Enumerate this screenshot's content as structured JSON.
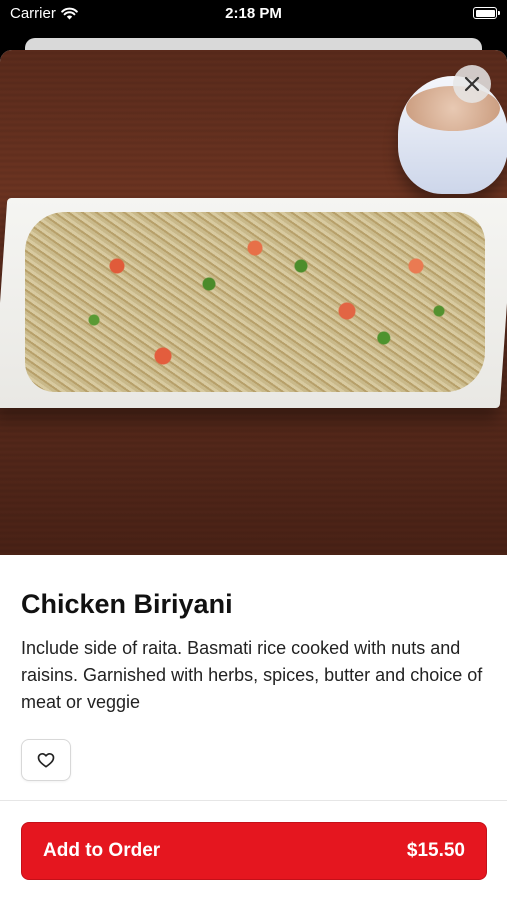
{
  "status_bar": {
    "carrier": "Carrier",
    "time": "2:18 PM",
    "icons": [
      "wifi-icon",
      "battery-icon"
    ]
  },
  "item": {
    "image_alt": "Chicken Biriyani dish photo",
    "name": "Chicken Biriyani",
    "description": "Include side of raita. Basmati rice cooked with nuts and raisins. Garnished with herbs, spices, butter and choice of meat or veggie"
  },
  "actions": {
    "close_icon": "close-icon",
    "favorite_icon": "heart-icon",
    "add_to_order_label": "Add to Order",
    "price": "$15.50"
  },
  "colors": {
    "accent": "#e5161f",
    "text": "#111111"
  }
}
